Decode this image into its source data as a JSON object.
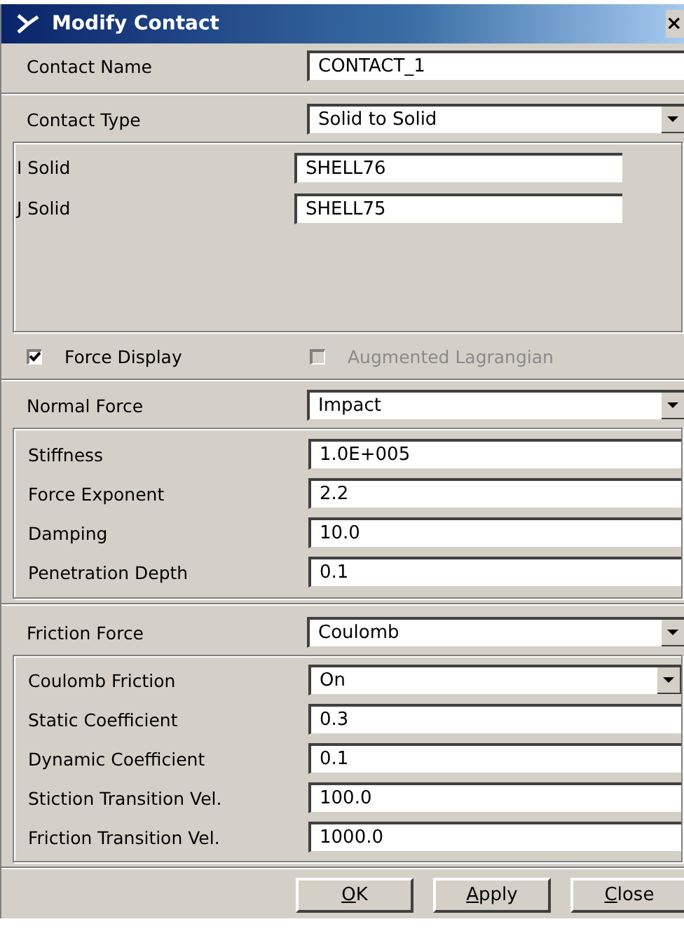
{
  "window": {
    "title": "Modify Contact",
    "close": "×"
  },
  "contact_name": {
    "label": "Contact Name",
    "value": "CONTACT_1"
  },
  "contact_type": {
    "label": "Contact Type",
    "value": "Solid to Solid"
  },
  "solids": [
    {
      "label": "I Solid",
      "value": "SHELL76"
    },
    {
      "label": "J Solid",
      "value": "SHELL75"
    }
  ],
  "options": [
    {
      "label": "Force Display",
      "checked": true,
      "disabled": false
    },
    {
      "label": "Augmented Lagrangian",
      "checked": false,
      "disabled": true
    }
  ],
  "normal_force": {
    "label": "Normal Force",
    "value": "Impact",
    "fields": [
      {
        "kind": "text",
        "label": "Stiffness",
        "value": "1.0E+005"
      },
      {
        "kind": "text",
        "label": "Force Exponent",
        "value": "2.2"
      },
      {
        "kind": "text",
        "label": "Damping",
        "value": "10.0"
      },
      {
        "kind": "text",
        "label": "Penetration Depth",
        "value": "0.1"
      }
    ]
  },
  "friction_force": {
    "label": "Friction Force",
    "value": "Coulomb",
    "fields": [
      {
        "kind": "dropdown",
        "label": "Coulomb Friction",
        "value": "On"
      },
      {
        "kind": "text",
        "label": "Static Coefficient",
        "value": "0.3"
      },
      {
        "kind": "text",
        "label": "Dynamic Coefficient",
        "value": "0.1"
      },
      {
        "kind": "text",
        "label": "Stiction Transition Vel.",
        "value": "100.0"
      },
      {
        "kind": "text",
        "label": "Friction Transition Vel.",
        "value": "1000.0"
      }
    ]
  },
  "buttons": [
    "OK",
    "Apply",
    "Close"
  ]
}
